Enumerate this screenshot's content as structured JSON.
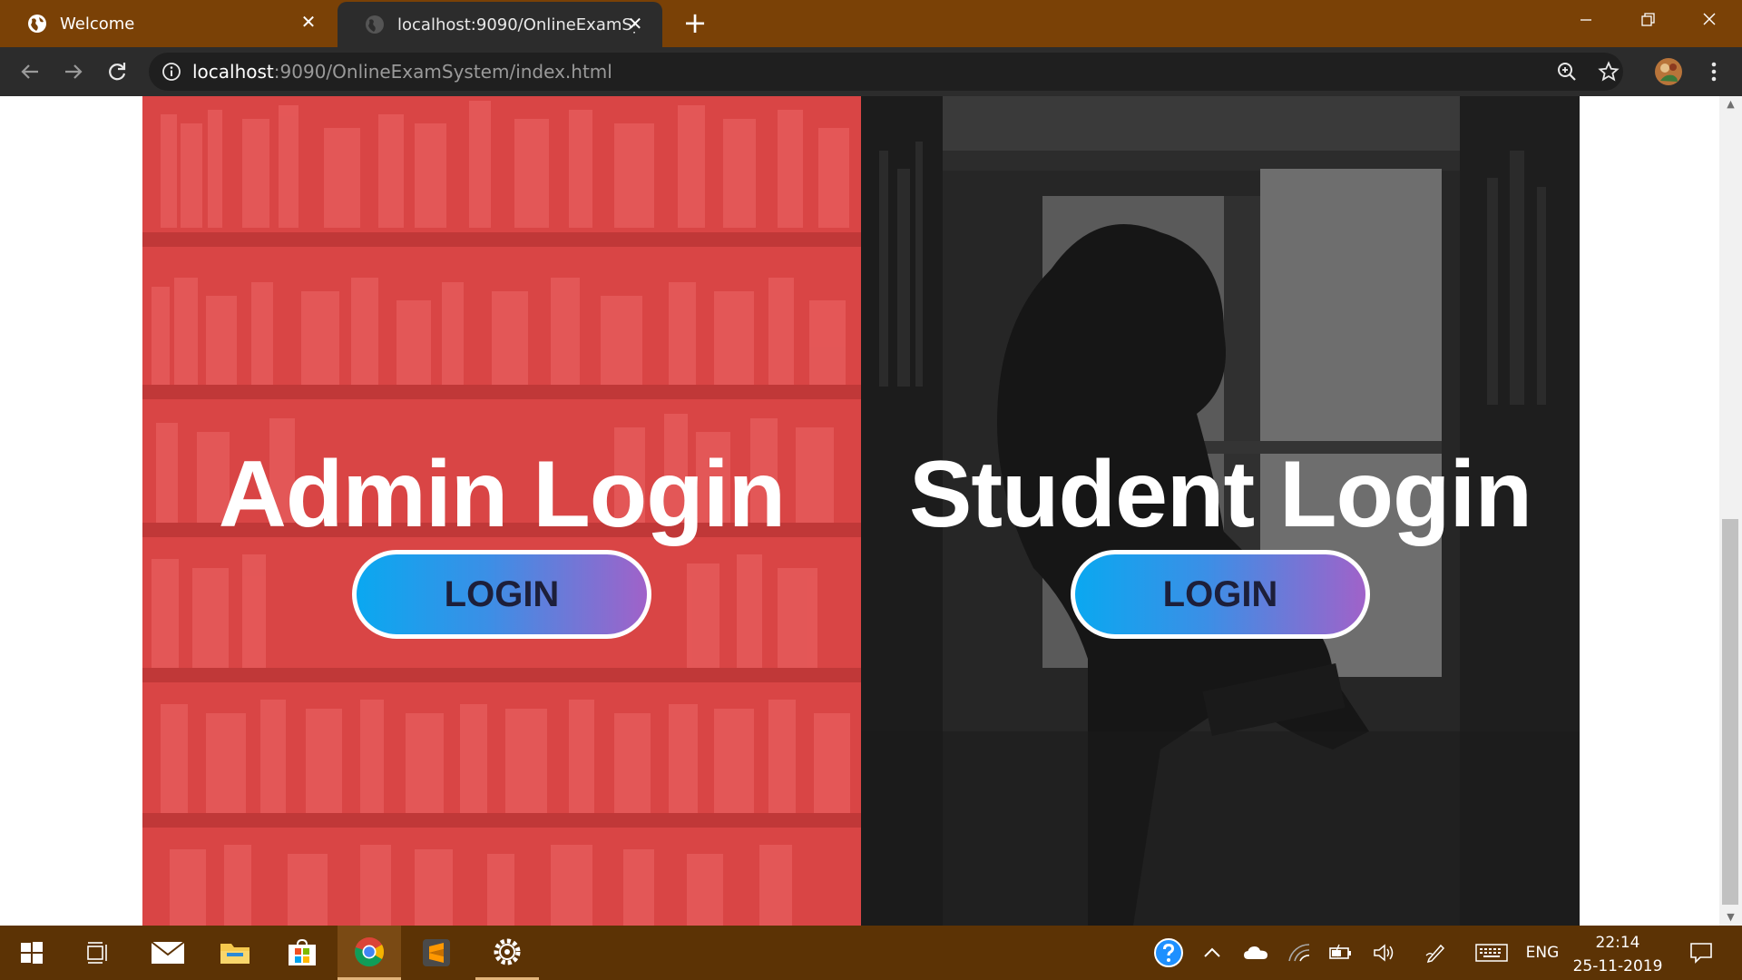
{
  "browser": {
    "tabs": [
      {
        "title": "Welcome",
        "active": false
      },
      {
        "title": "localhost:9090/OnlineExamSystem/index.html",
        "active": true
      }
    ],
    "address": {
      "host": "localhost",
      "path": ":9090/OnlineExamSystem/index.html"
    }
  },
  "page": {
    "admin": {
      "title": "Admin Login",
      "button": "LOGIN"
    },
    "student": {
      "title": "Student Login",
      "button": "LOGIN"
    }
  },
  "taskbar": {
    "apps": [
      "start",
      "task-view",
      "mail",
      "file-explorer",
      "store",
      "chrome",
      "sublime-text",
      "settings"
    ],
    "tray": {
      "language": "ENG",
      "time": "22:14",
      "date": "25-11-2019"
    }
  },
  "colors": {
    "tabbar": "#7a4106",
    "taskbar": "#5c3305",
    "admin_overlay": "#d94545",
    "student_overlay": "#262626",
    "button_gradient_start": "#0aa8f0",
    "button_gradient_end": "#a062c9"
  }
}
